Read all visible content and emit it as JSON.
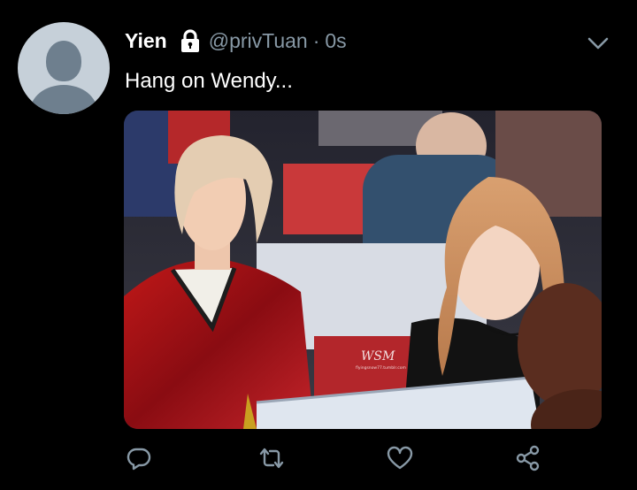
{
  "tweet": {
    "author_name": "Yien",
    "author_handle": "@privTuan",
    "separator": "·",
    "timestamp": "0s",
    "text": "Hang on Wendy...",
    "protected_icon": "lock-icon",
    "menu_icon": "chevron-down-icon"
  },
  "media": {
    "watermark": "WSM",
    "watermark_sub": "flyingsnow77.tumblr.com"
  },
  "actions": {
    "reply_icon": "reply-icon",
    "retweet_icon": "retweet-icon",
    "like_icon": "heart-icon",
    "share_icon": "share-icon"
  },
  "colors": {
    "background": "#000000",
    "primary_text": "#ffffff",
    "secondary_text": "#8899a6",
    "avatar_bg": "#c6d0d9",
    "avatar_fg": "#6e7f8e"
  }
}
